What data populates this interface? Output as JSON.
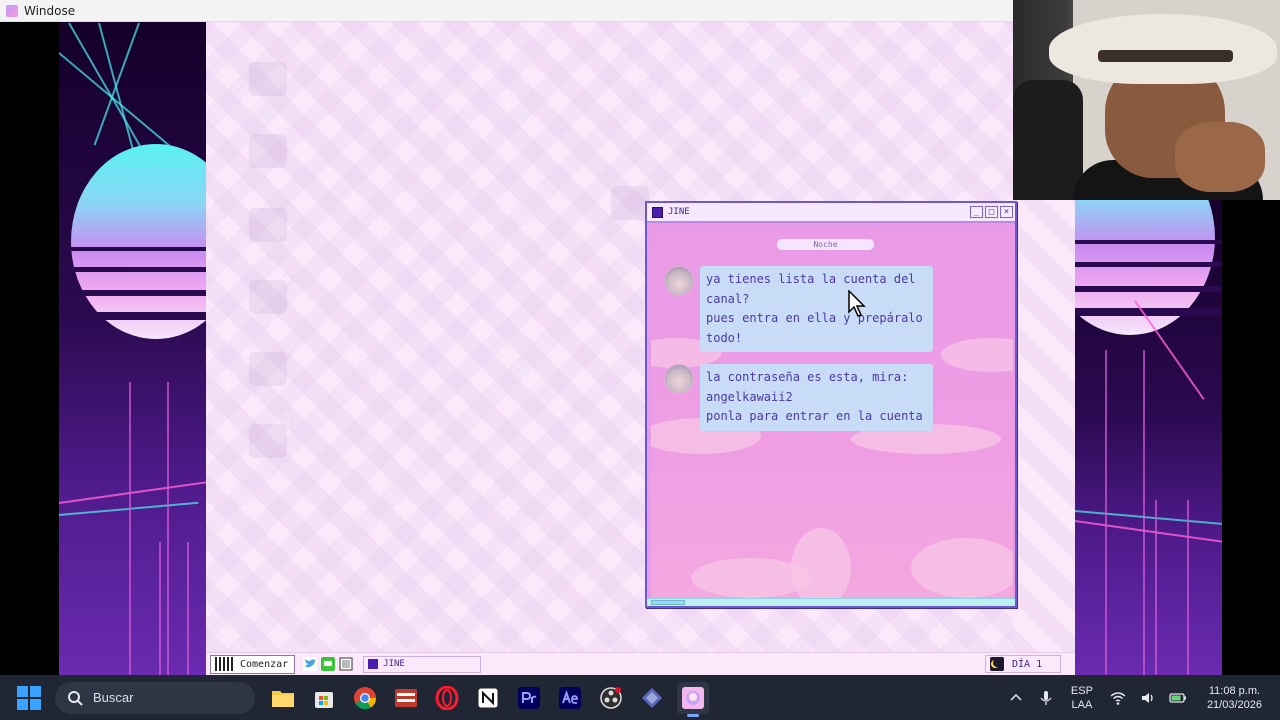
{
  "host_window": {
    "title": "Windose"
  },
  "jine": {
    "title": "JINE",
    "day_label": "Noche",
    "controls": {
      "minimize": "_",
      "maximize": "□",
      "close": "×"
    },
    "messages": [
      {
        "text": "ya tienes lista la cuenta del\ncanal?\npues entra en ella y prepáralo\ntodo!"
      },
      {
        "text": "la contraseña es esta, mira:\nangelkawaii2\nponla para entrar en la cuenta"
      }
    ]
  },
  "game_taskbar": {
    "start_label": "Comenzar",
    "task_label": "JINE",
    "day_counter": "DÍA 1"
  },
  "windows_taskbar": {
    "search_placeholder": "Buscar",
    "language": "ESP",
    "layout": "LAA",
    "time": "11:08 p.m.",
    "date": "21/03/2026",
    "pinned_apps": [
      "file-explorer",
      "microsoft-store",
      "chrome",
      "voicemeeter",
      "opera",
      "notion",
      "premiere-pro",
      "after-effects",
      "obs-studio",
      "visual-studio",
      "windose-game"
    ]
  },
  "colors": {
    "jine_bubble": "#c9dcf7",
    "jine_text": "#4b3aa0",
    "jine_background": "#e69ae8",
    "desktop_background": "#fbe9fb",
    "windows_taskbar": "#202634"
  }
}
